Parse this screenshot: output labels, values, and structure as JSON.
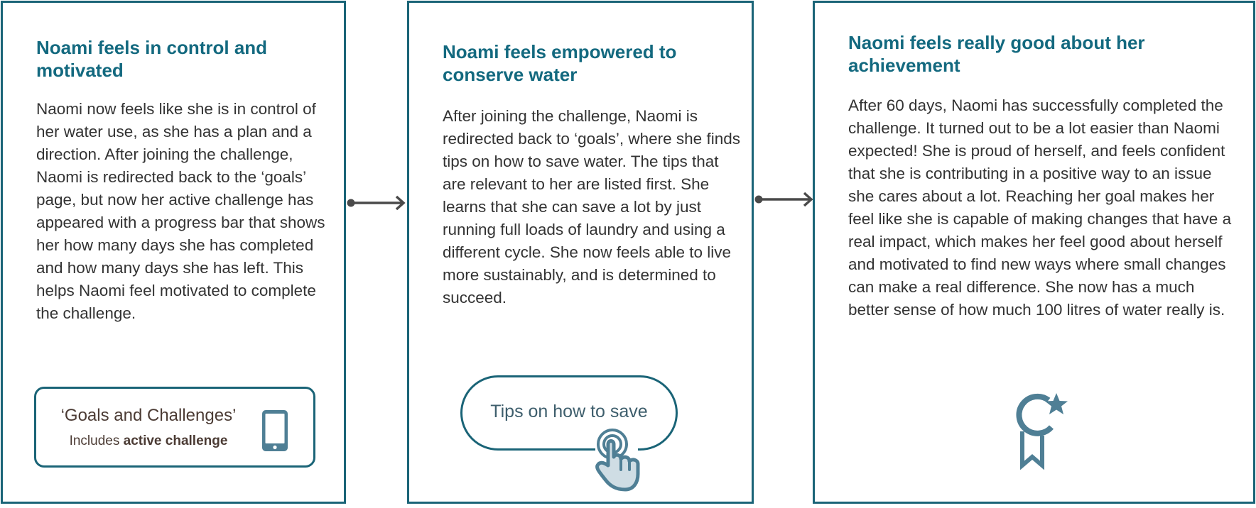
{
  "panels": [
    {
      "title": "Noami feels in control and motivated",
      "body": "Naomi now feels like she is in control of her water use, as she has a plan and a direction. After joining the challenge, Naomi is redirected back to the ‘goals’ page, but now her active challenge has appeared with a progress bar that shows her how many days she has completed and how many days she has left. This helps Naomi feel motivated to complete the challenge.",
      "card": {
        "title": "‘Goals and Challenges’",
        "subtitle_prefix": "Includes ",
        "subtitle_bold": "active challenge",
        "icon": "phone-icon"
      }
    },
    {
      "title": "Noami feels empowered to conserve water",
      "body": "After joining the challenge, Naomi is redirected back to ‘goals’, where she finds tips on how to save water. The tips that are relevant to her are listed first. She learns that she can save a lot by just running full loads of laundry and using a different cycle. She now feels able to live more sustainably, and is determined to succeed.",
      "button": {
        "label": "Tips on how to save",
        "icon": "pointing-hand-icon"
      }
    },
    {
      "title": "Naomi feels really good about her achievement",
      "body": "After 60 days, Naomi has successfully completed the challenge. It turned out to be a lot easier than Naomi expected! She is proud of herself, and feels confident that she is contributing in a positive way to an issue she cares about a lot. Reaching her goal makes her feel like she is capable of making changes that have a real impact, which makes her feel good about herself and motivated to find new ways where small changes can make a real difference. She now has a much better sense of how much 100 litres of water really is.",
      "icon": "award-ribbon-icon"
    }
  ],
  "colors": {
    "border": "#1a6477",
    "title": "#13697f",
    "body_text": "#333333",
    "icon": "#4f7f95",
    "arrow": "#4a4a4a"
  }
}
